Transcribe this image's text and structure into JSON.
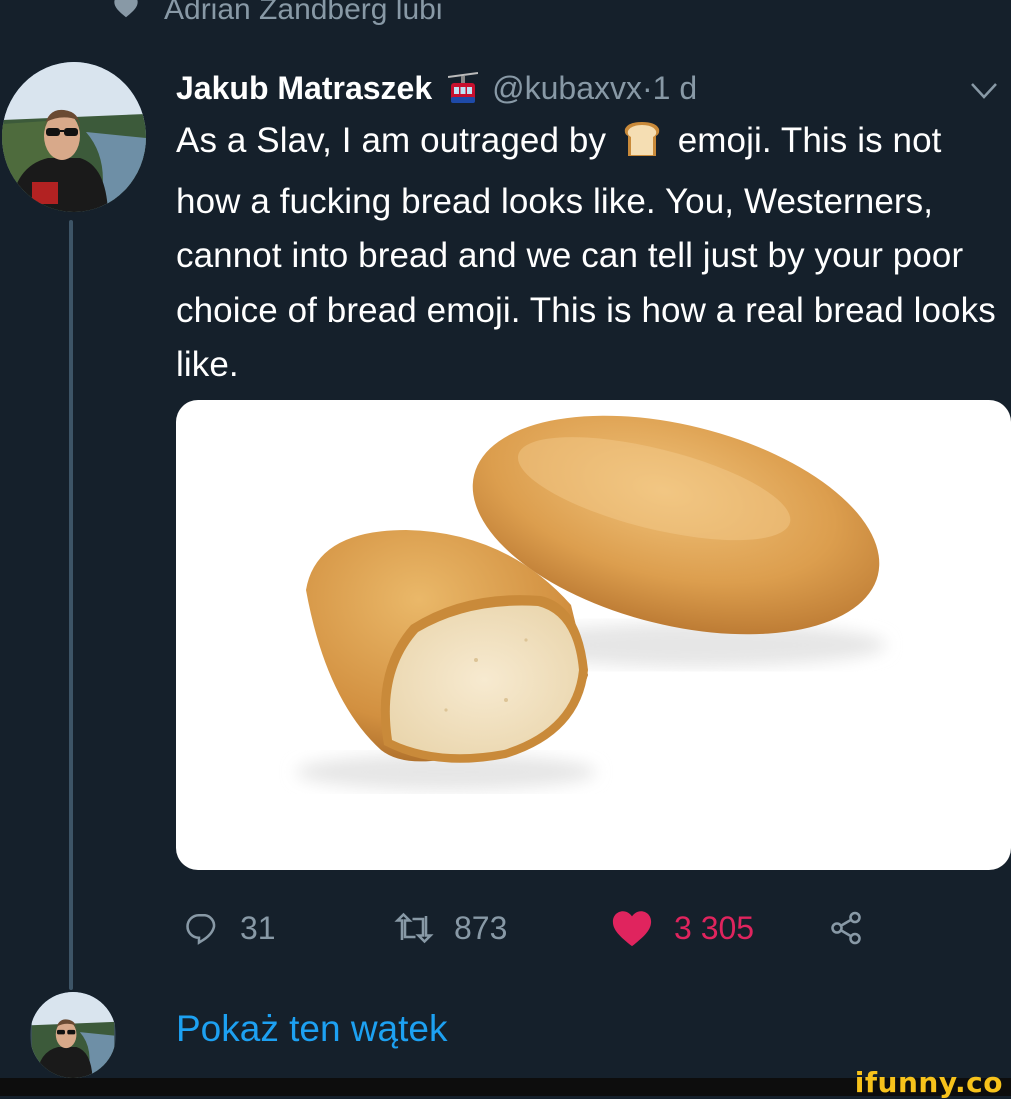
{
  "context_line": {
    "icon": "heart-icon",
    "text": "Adrian Zandberg lubi"
  },
  "tweet": {
    "author_name": "Jakub Matraszek",
    "name_emoji": "aerial-tramway-emoji",
    "handle": "@kubaxvx",
    "separator": " · ",
    "time": "1 d",
    "text_before_emoji": "As a Slav, I am outraged by ",
    "inline_emoji": "bread-emoji",
    "text_after_emoji": " emoji. This is not how a fucking bread looks like. You, Westerners, cannot into bread and we can tell just by your poor choice of bread emoji. This is how a real bread looks like.",
    "media": "bread-loaf-photo",
    "actions": {
      "replies": "31",
      "retweets": "873",
      "likes": "3 305"
    }
  },
  "show_thread_label": "Pokaż ten wątek",
  "watermark": "ifunny.co",
  "colors": {
    "background": "#15202b",
    "secondary_text": "#8899a6",
    "like": "#e0245e",
    "link": "#1da1f2"
  }
}
